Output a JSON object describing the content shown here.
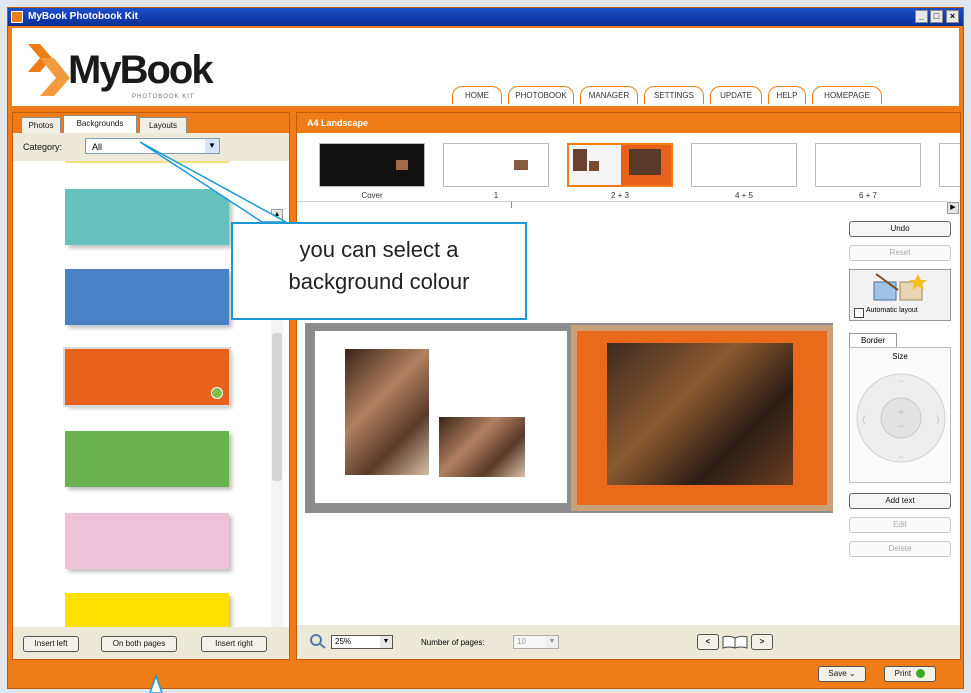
{
  "window": {
    "title": "MyBook Photobook Kit",
    "controls": [
      "_",
      "□",
      "×"
    ]
  },
  "logo": {
    "brand": "MyBook",
    "sub": "PHOTOBOOK KIT"
  },
  "nav": {
    "tabs": [
      "HOME",
      "PHOTOBOOK",
      "MANAGER",
      "SETTINGS",
      "UPDATE",
      "HELP",
      "HOMEPAGE"
    ]
  },
  "left": {
    "tabs": [
      "Photos",
      "Backgrounds",
      "Layouts"
    ],
    "active_tab": "Backgrounds",
    "category_label": "Category:",
    "category_value": "All",
    "swatches": [
      "#66c1bd",
      "#4a80c4",
      "#e9621b",
      "#6ab24f",
      "#eec3d8",
      "#ffe000"
    ],
    "selected_swatch_index": 2,
    "buttons": {
      "insert_left": "Insert left",
      "both_pages": "On both pages",
      "insert_right": "Insert right"
    }
  },
  "right": {
    "title": "A4 Landscape",
    "thumbnails": [
      "Cover",
      "1",
      "2 + 3",
      "4 + 5",
      "6 + 7"
    ],
    "tools": {
      "undo": "Undo",
      "reset": "Reset",
      "auto_layout": "Automatic layout",
      "border_tab": "Border",
      "size_label": "Size",
      "add_text": "Add text",
      "edit": "Edit",
      "delete": "Delete"
    },
    "bottom": {
      "zoom": "25%",
      "num_pages_label": "Number of pages:",
      "num_pages": "10",
      "prev": "<",
      "next": ">"
    }
  },
  "footer": {
    "save": "Save",
    "print": "Print"
  },
  "callout": {
    "line1": "you can select a",
    "line2": "background colour"
  }
}
